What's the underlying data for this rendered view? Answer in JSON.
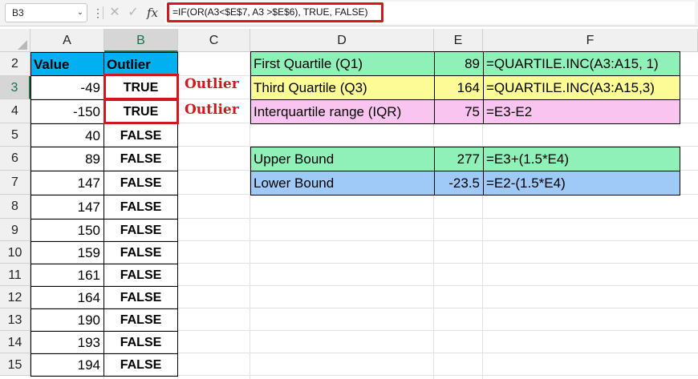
{
  "formula_bar": {
    "name_box": "B3",
    "name_box_arrow": "⌄",
    "dots": "⋮",
    "cancel_glyph": "✕",
    "enter_glyph": "✓",
    "fx_glyph": "fx",
    "formula": "=IF(OR(A3<$E$7, A3 >$E$6), TRUE, FALSE)"
  },
  "columns": [
    "A",
    "B",
    "C",
    "D",
    "E",
    "F"
  ],
  "selected_cell": "B3",
  "rows": [
    "2",
    "3",
    "4",
    "5",
    "6",
    "7",
    "8",
    "9",
    "10",
    "11",
    "12",
    "13",
    "14",
    "15"
  ],
  "table": {
    "headers": {
      "value": "Value",
      "outlier": "Outlier"
    },
    "values": [
      "-49",
      "-150",
      "40",
      "89",
      "147",
      "147",
      "150",
      "159",
      "161",
      "164",
      "190",
      "193",
      "194"
    ],
    "outliers": [
      "TRUE",
      "TRUE",
      "FALSE",
      "FALSE",
      "FALSE",
      "FALSE",
      "FALSE",
      "FALSE",
      "FALSE",
      "FALSE",
      "FALSE",
      "FALSE",
      "FALSE"
    ]
  },
  "notes": [
    "Outlier",
    "Outlier"
  ],
  "stats": [
    {
      "label": "First Quartile (Q1)",
      "value": "89",
      "formula": "=QUARTILE.INC(A3:A15, 1)",
      "color": "#8ff0b8"
    },
    {
      "label": "Third Quartile (Q3)",
      "value": "164",
      "formula": "=QUARTILE.INC(A3:A15,3)",
      "color": "#fdfb95"
    },
    {
      "label": "Interquartile range (IQR)",
      "value": "75",
      "formula": "=E3-E2",
      "color": "#f9c4ef"
    }
  ],
  "bounds": [
    {
      "label": "Upper Bound",
      "value": "277",
      "formula": "=E3+(1.5*E4)",
      "color": "#8ff0b8"
    },
    {
      "label": "Lower Bound",
      "value": "-23.5",
      "formula": "=E2-(1.5*E4)",
      "color": "#9fc9f7"
    }
  ],
  "colors": {
    "header_fill": "#00b0f0",
    "highlight": "#d4171e",
    "accent": "#1e7145"
  }
}
